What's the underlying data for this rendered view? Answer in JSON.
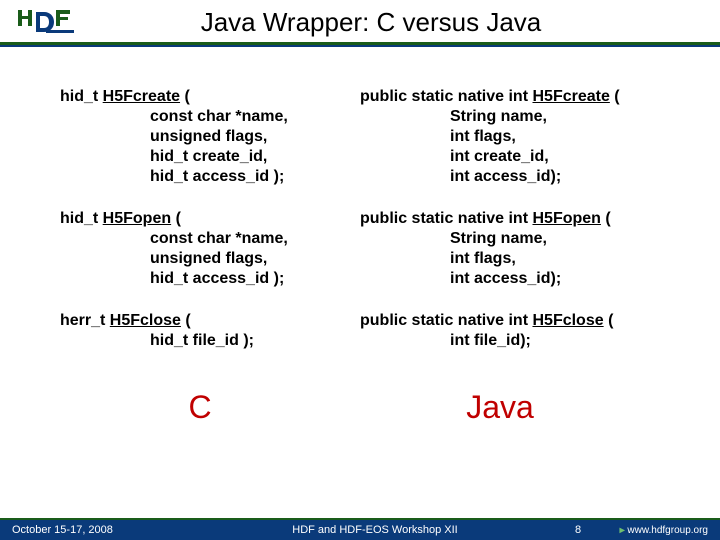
{
  "title": "Java Wrapper: C versus Java",
  "c": {
    "fcreate": {
      "ret": "hid_t ",
      "name": "H5Fcreate",
      "open": " (",
      "a1": "const char *name,",
      "a2": "unsigned flags,",
      "a3": "hid_t create_id,",
      "a4": "hid_t access_id  );"
    },
    "fopen": {
      "ret": "hid_t ",
      "name": "H5Fopen",
      "open": " (",
      "a1": "const char *name,",
      "a2": "unsigned flags,",
      "a3": "hid_t access_id );"
    },
    "fclose": {
      "ret": "herr_t ",
      "name": "H5Fclose",
      "open": " (",
      "a1": "hid_t file_id );"
    }
  },
  "j": {
    "fcreate": {
      "ret": "public static native int ",
      "name": "H5Fcreate",
      "open": " (",
      "a1": "String name,",
      "a2": "int flags,",
      "a3": "int create_id,",
      "a4": "int access_id);"
    },
    "fopen": {
      "ret": "public static native  int ",
      "name": "H5Fopen",
      "open": " (",
      "a1": "String name,",
      "a2": "int flags,",
      "a3": "int access_id);"
    },
    "fclose": {
      "ret": "public static native int ",
      "name": "H5Fclose",
      "open": " (",
      "a1": "int file_id);"
    }
  },
  "labels": {
    "c": "C",
    "java": "Java"
  },
  "footer": {
    "date": "October 15-17, 2008",
    "mid": "HDF and HDF-EOS Workshop XII",
    "page": "8",
    "url": "www.hdfgroup.org"
  }
}
